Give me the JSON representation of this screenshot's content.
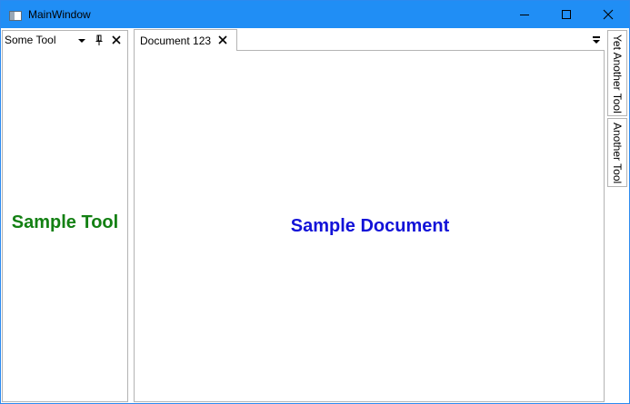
{
  "window": {
    "title": "MainWindow",
    "accent_color": "#208ef5"
  },
  "tool_pane": {
    "title": "Some Tool",
    "body_text": "Sample Tool",
    "body_color": "#138013"
  },
  "document": {
    "tab_title": "Document 123",
    "body_text": "Sample Document",
    "body_color": "#1212d8"
  },
  "side_tabs": [
    {
      "label": "Yet Another Tool"
    },
    {
      "label": "Another Tool"
    }
  ],
  "icons": {
    "app": "app-window-icon",
    "minimize": "minimize-icon",
    "maximize": "maximize-icon",
    "close": "close-icon",
    "tool_menu": "dropdown-arrow-icon",
    "pin": "pin-icon",
    "doc_menu": "document-list-icon"
  }
}
